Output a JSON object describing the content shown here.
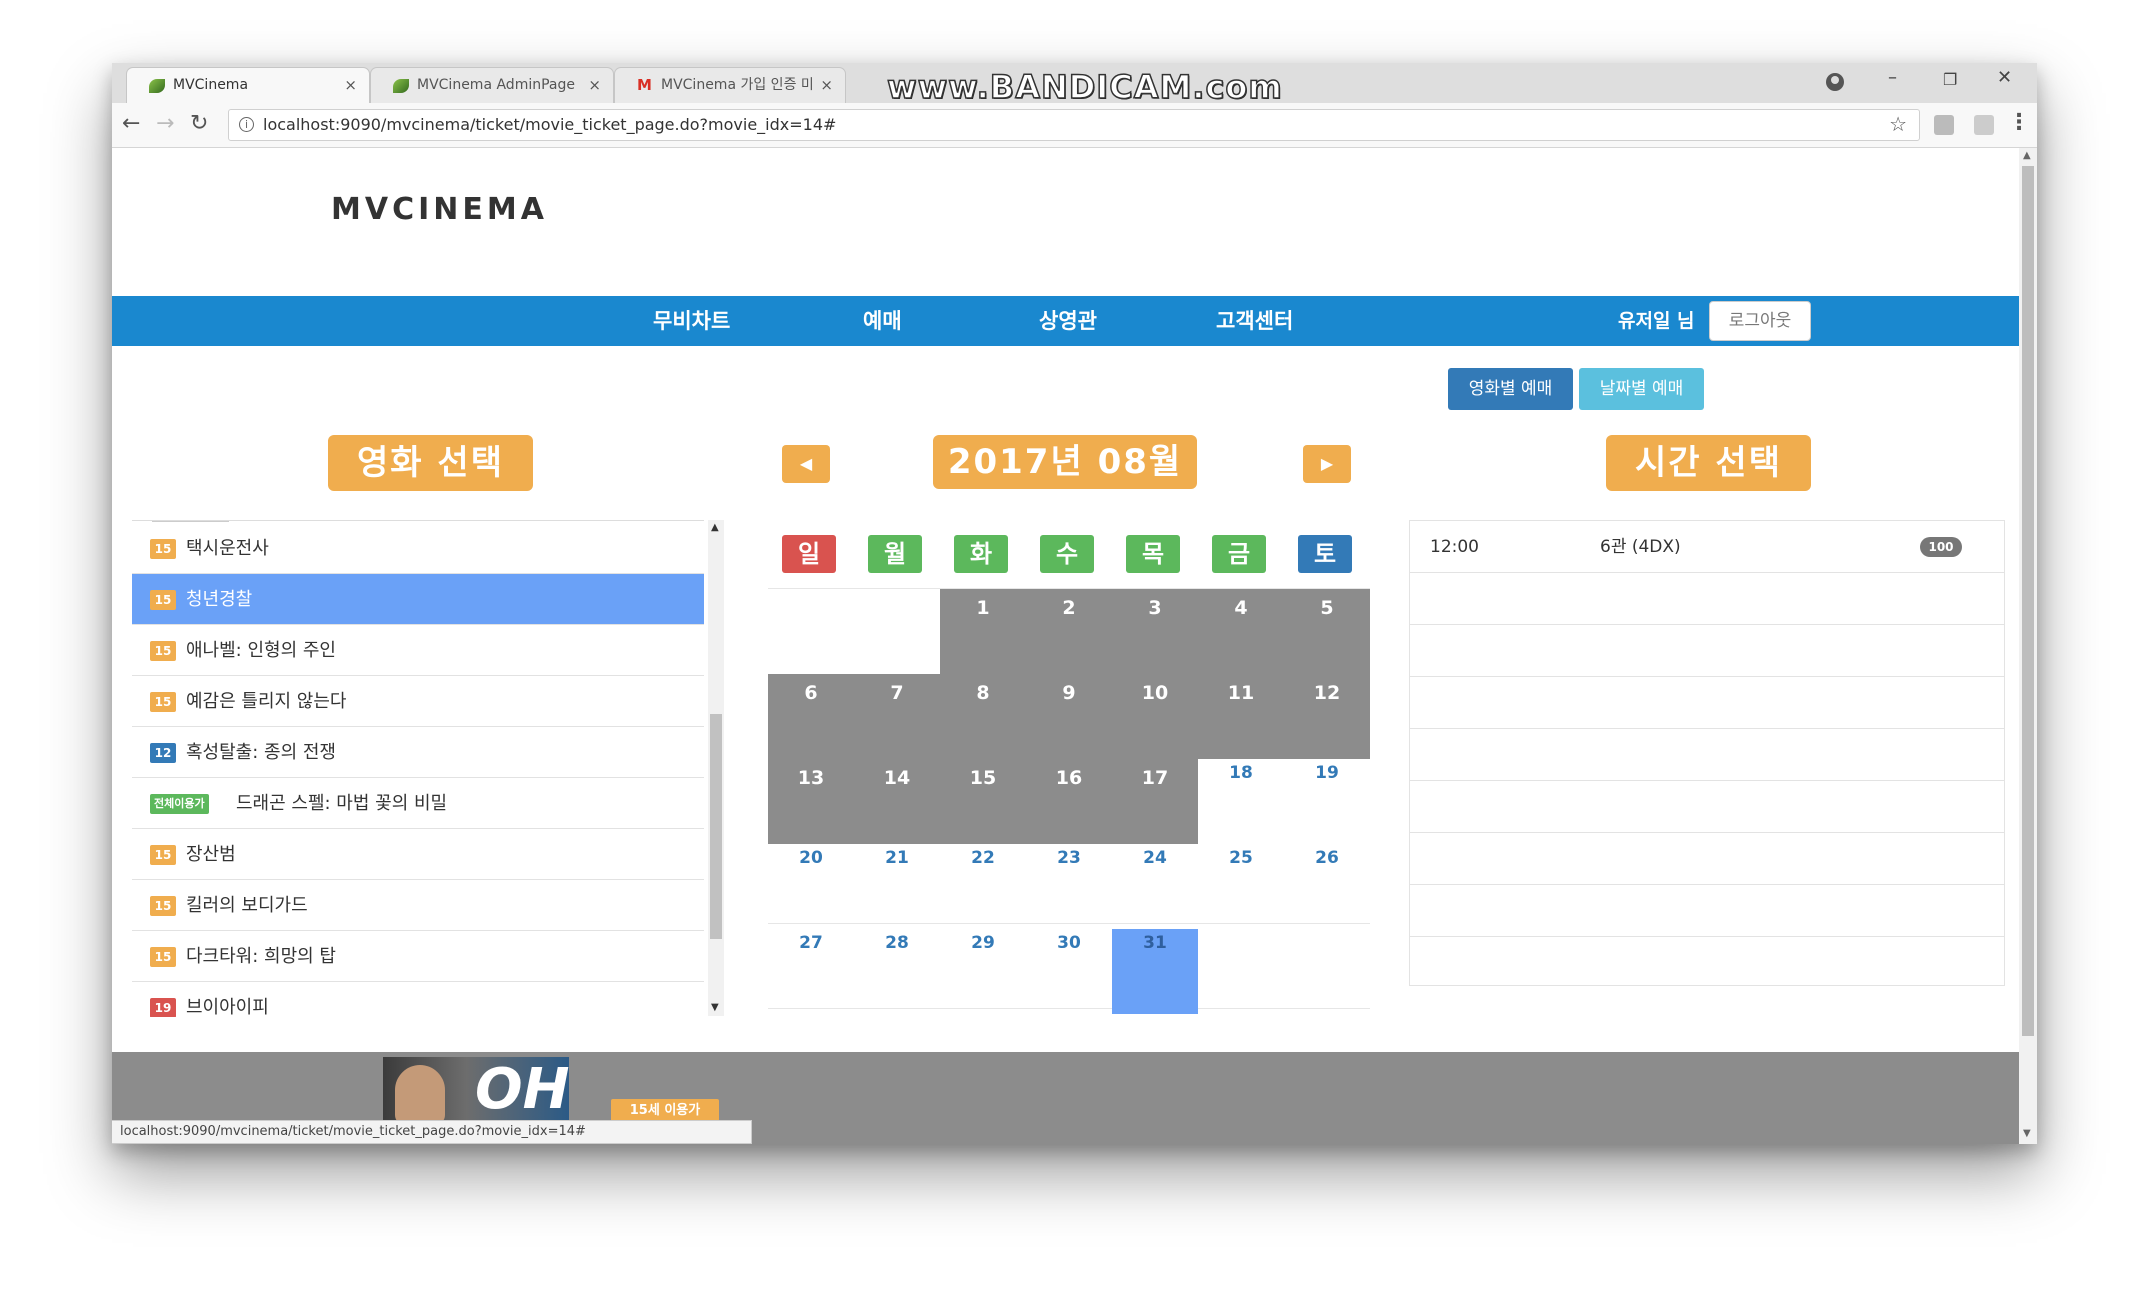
{
  "browser": {
    "tabs": [
      {
        "title": "MVCinema",
        "active": true
      },
      {
        "title": "MVCinema AdminPage",
        "active": false
      },
      {
        "title": "MVCinema 가입 인증 미",
        "active": false
      }
    ],
    "tab_close": "×",
    "watermark": "www.BANDICAM.com",
    "url": "localhost:9090/mvcinema/ticket/movie_ticket_page.do?movie_idx=14#",
    "status_url": "localhost:9090/mvcinema/ticket/movie_ticket_page.do?movie_idx=14#"
  },
  "header": {
    "logo": "MVCINEMA",
    "nav": [
      "무비차트",
      "예매",
      "상영관",
      "고객센터"
    ],
    "user": "유저일 님",
    "logout": "로그아웃"
  },
  "mode_buttons": {
    "by_movie": "영화별 예매",
    "by_date": "날짜별 예매"
  },
  "sections": {
    "movie_title": "영화 선택",
    "time_title": "시간 선택"
  },
  "calendar": {
    "title": "2017년 08월",
    "prev": "◀",
    "next": "▶",
    "weekdays": [
      "일",
      "월",
      "화",
      "수",
      "목",
      "금",
      "토"
    ],
    "days": [
      "1",
      "2",
      "3",
      "4",
      "5",
      "6",
      "7",
      "8",
      "9",
      "10",
      "11",
      "12",
      "13",
      "14",
      "15",
      "16",
      "17",
      "18",
      "19",
      "20",
      "21",
      "22",
      "23",
      "24",
      "25",
      "26",
      "27",
      "28",
      "29",
      "30",
      "31"
    ],
    "selected_day": "31"
  },
  "movies": [
    {
      "rating": "15",
      "title": "택시운전사"
    },
    {
      "rating": "15",
      "title": "청년경찰",
      "selected": true
    },
    {
      "rating": "15",
      "title": "애나벨: 인형의 주인"
    },
    {
      "rating": "15",
      "title": "예감은 틀리지 않는다"
    },
    {
      "rating": "12",
      "title": "혹성탈출: 종의 전쟁"
    },
    {
      "rating": "전체이용가",
      "title": "드래곤 스펠: 마법 꽃의 비밀"
    },
    {
      "rating": "15",
      "title": "장산범"
    },
    {
      "rating": "15",
      "title": "킬러의 보디가드"
    },
    {
      "rating": "15",
      "title": "다크타워: 희망의 탑"
    },
    {
      "rating": "19",
      "title": "브이아이피"
    }
  ],
  "times": [
    {
      "time": "12:00",
      "hall": "6관 (4DX)",
      "seats": "100"
    }
  ],
  "footer": {
    "age_label": "15세 이용가",
    "poster_text": "OH!"
  },
  "colors": {
    "nav_blue": "#1a88cf",
    "orange": "#f0ad4e",
    "selected_blue": "#6aa1f7",
    "past_gray": "#8c8c8c"
  }
}
